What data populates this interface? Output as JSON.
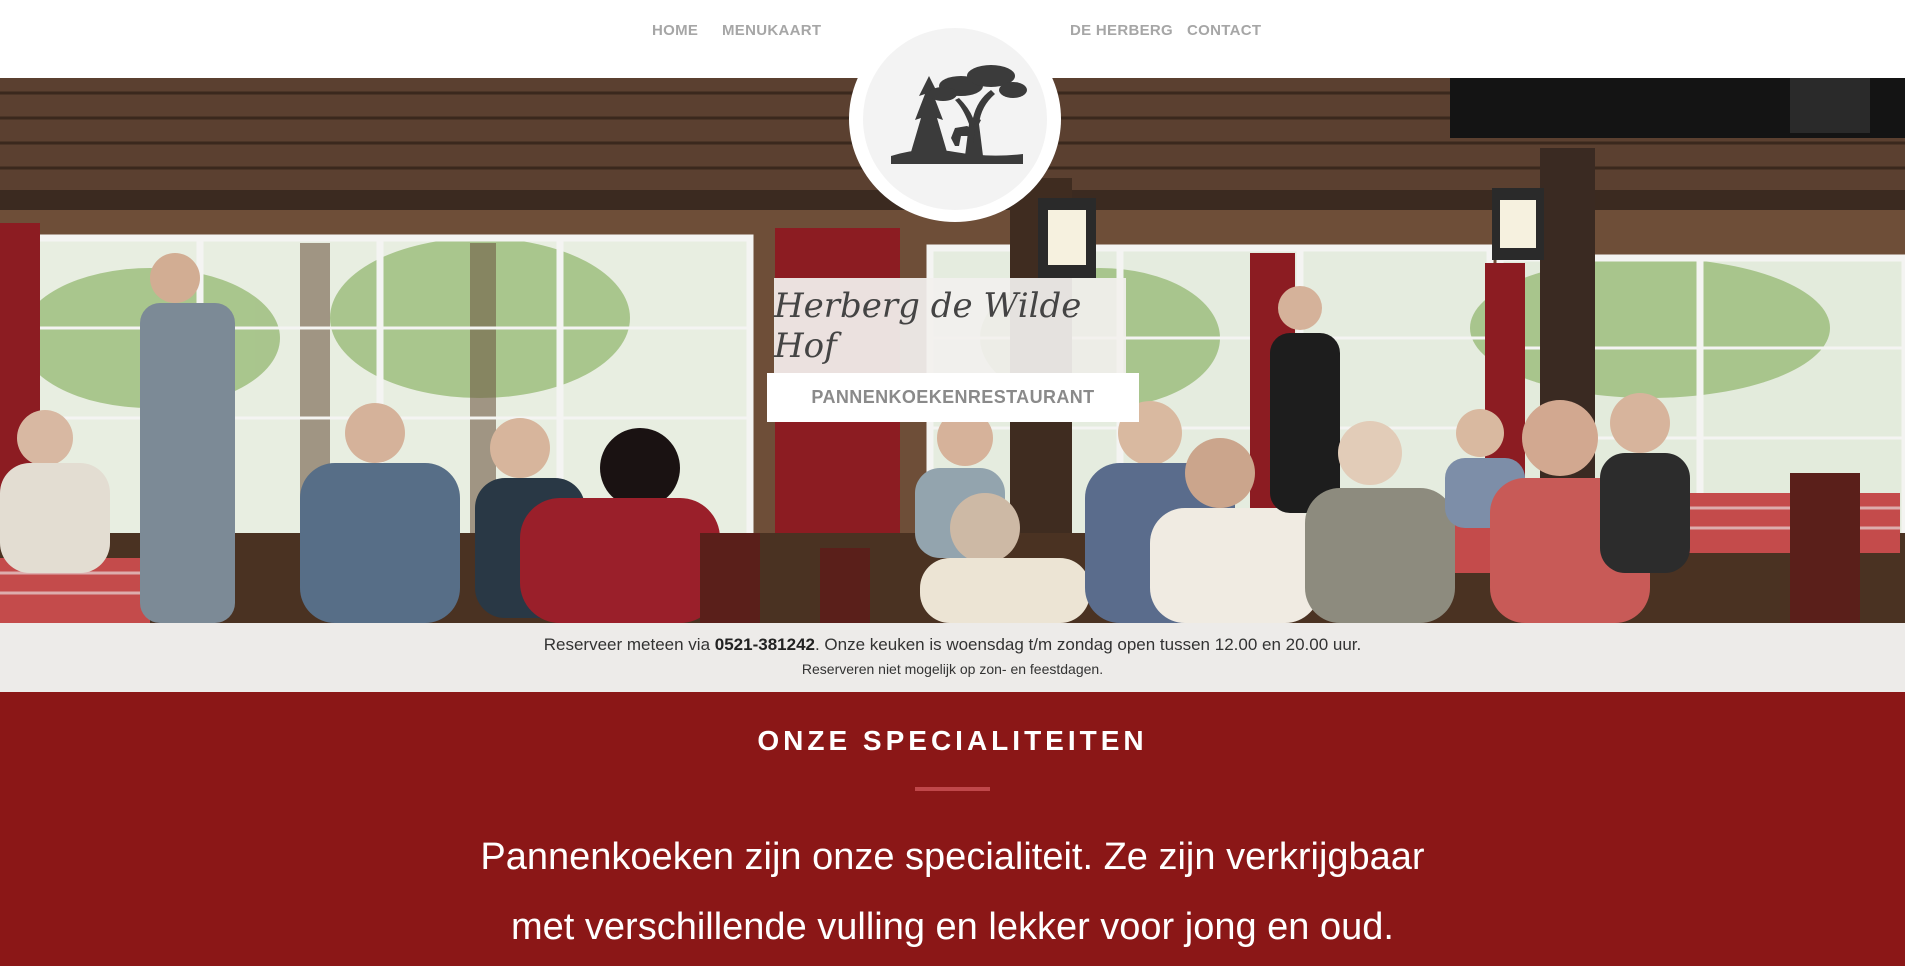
{
  "nav": {
    "left": [
      {
        "label": "HOME"
      },
      {
        "label": "MENUKAART"
      }
    ],
    "right": [
      {
        "label": "DE HERBERG"
      },
      {
        "label": "CONTACT"
      }
    ]
  },
  "logo": {
    "icon": "deer-tree-logo-icon"
  },
  "hero": {
    "title": "Herberg de Wilde Hof",
    "subtitle": "PANNENKOEKENRESTAURANT"
  },
  "reservation": {
    "prefix": "Reserveer meteen via ",
    "phone": "0521-381242",
    "suffix": ". Onze keuken is woensdag t/m zondag open tussen 12.00 en 20.00 uur.",
    "note": "Reserveren niet mogelijk op zon- en feestdagen."
  },
  "specialities": {
    "heading": "ONZE SPECIALITEITEN",
    "body": "Pannenkoeken zijn onze specialiteit. Ze zijn verkrijgbaar met verschillende vulling en lekker voor jong en oud."
  },
  "colors": {
    "accent": "#8b1717",
    "nav_text": "#a6a6a6",
    "rule": "#c0474a"
  }
}
